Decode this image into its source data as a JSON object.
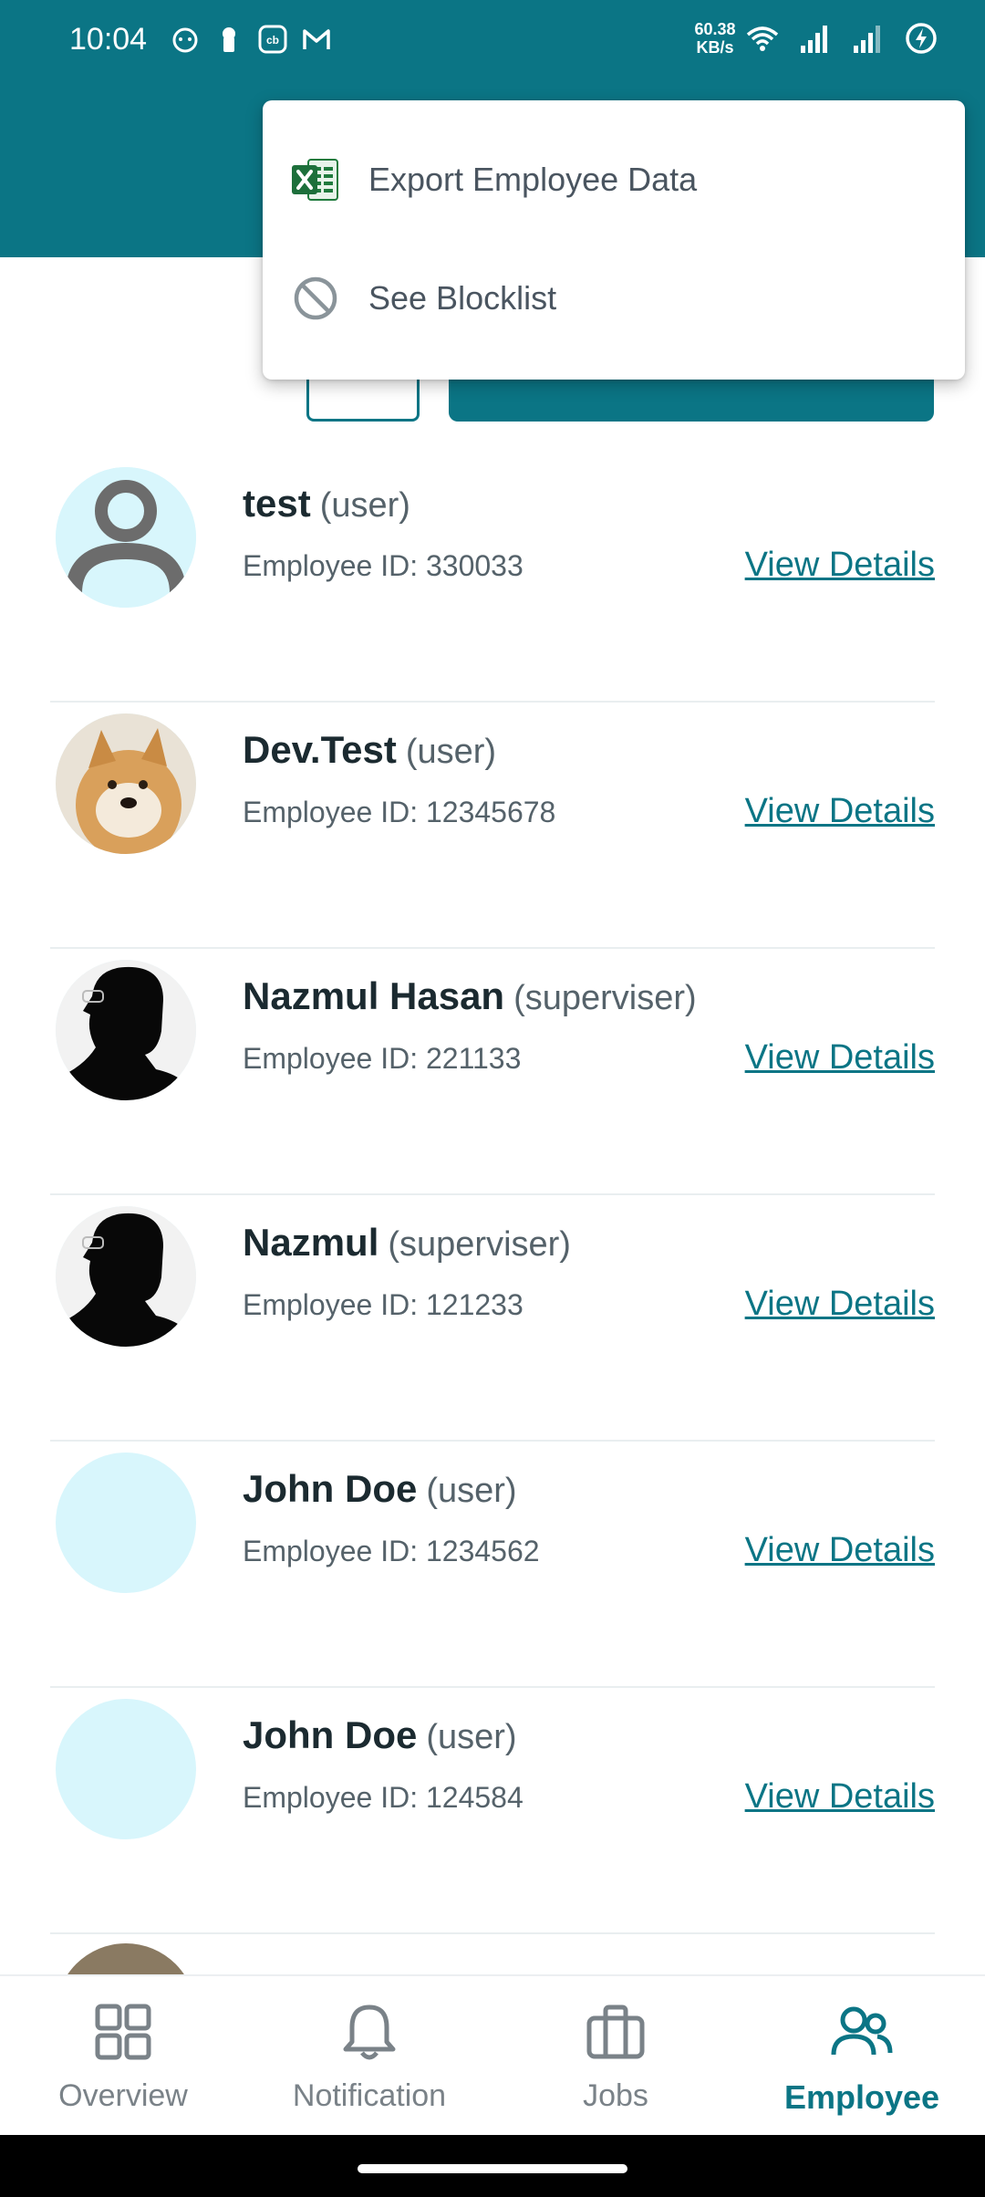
{
  "status_bar": {
    "time": "10:04",
    "net_speed_value": "60.38",
    "net_speed_unit": "KB/s",
    "left_icons": [
      "face-app-icon",
      "keyhole-icon",
      "cb-app-icon",
      "gmail-icon"
    ],
    "right_icons": [
      "wifi-icon",
      "signal-icon",
      "signal-icon",
      "battery-charging-icon"
    ]
  },
  "menu": {
    "items": [
      {
        "label": "Export Employee Data",
        "icon": "excel-icon"
      },
      {
        "label": "See Blocklist",
        "icon": "block-icon"
      }
    ]
  },
  "employees": [
    {
      "name": "test",
      "role": "(user)",
      "id_label": "Employee ID: 330033",
      "link": "View Details",
      "avatar": "default-person"
    },
    {
      "name": "Dev.Test",
      "role": "(user)",
      "id_label": "Employee ID: 12345678",
      "link": "View Details",
      "avatar": "dog-photo"
    },
    {
      "name": "Nazmul Hasan",
      "role": "(superviser)",
      "id_label": "Employee ID: 221133",
      "link": "View Details",
      "avatar": "silhouette-photo"
    },
    {
      "name": "Nazmul",
      "role": "(superviser)",
      "id_label": "Employee ID: 121233",
      "link": "View Details",
      "avatar": "silhouette-photo"
    },
    {
      "name": "John Doe",
      "role": "(user)",
      "id_label": "Employee ID: 1234562",
      "link": "View Details",
      "avatar": "empty"
    },
    {
      "name": "John Doe",
      "role": "(user)",
      "id_label": "Employee ID: 124584",
      "link": "View Details",
      "avatar": "empty"
    }
  ],
  "bottom_nav": {
    "items": [
      {
        "label": "Overview",
        "icon": "grid-icon",
        "active": false
      },
      {
        "label": "Notification",
        "icon": "bell-icon",
        "active": false
      },
      {
        "label": "Jobs",
        "icon": "briefcase-icon",
        "active": false
      },
      {
        "label": "Employee",
        "icon": "people-icon",
        "active": true
      }
    ]
  },
  "colors": {
    "primary": "#0b7585",
    "avatar_bg": "#d8f6fc",
    "nav_inactive": "#7a8288"
  }
}
